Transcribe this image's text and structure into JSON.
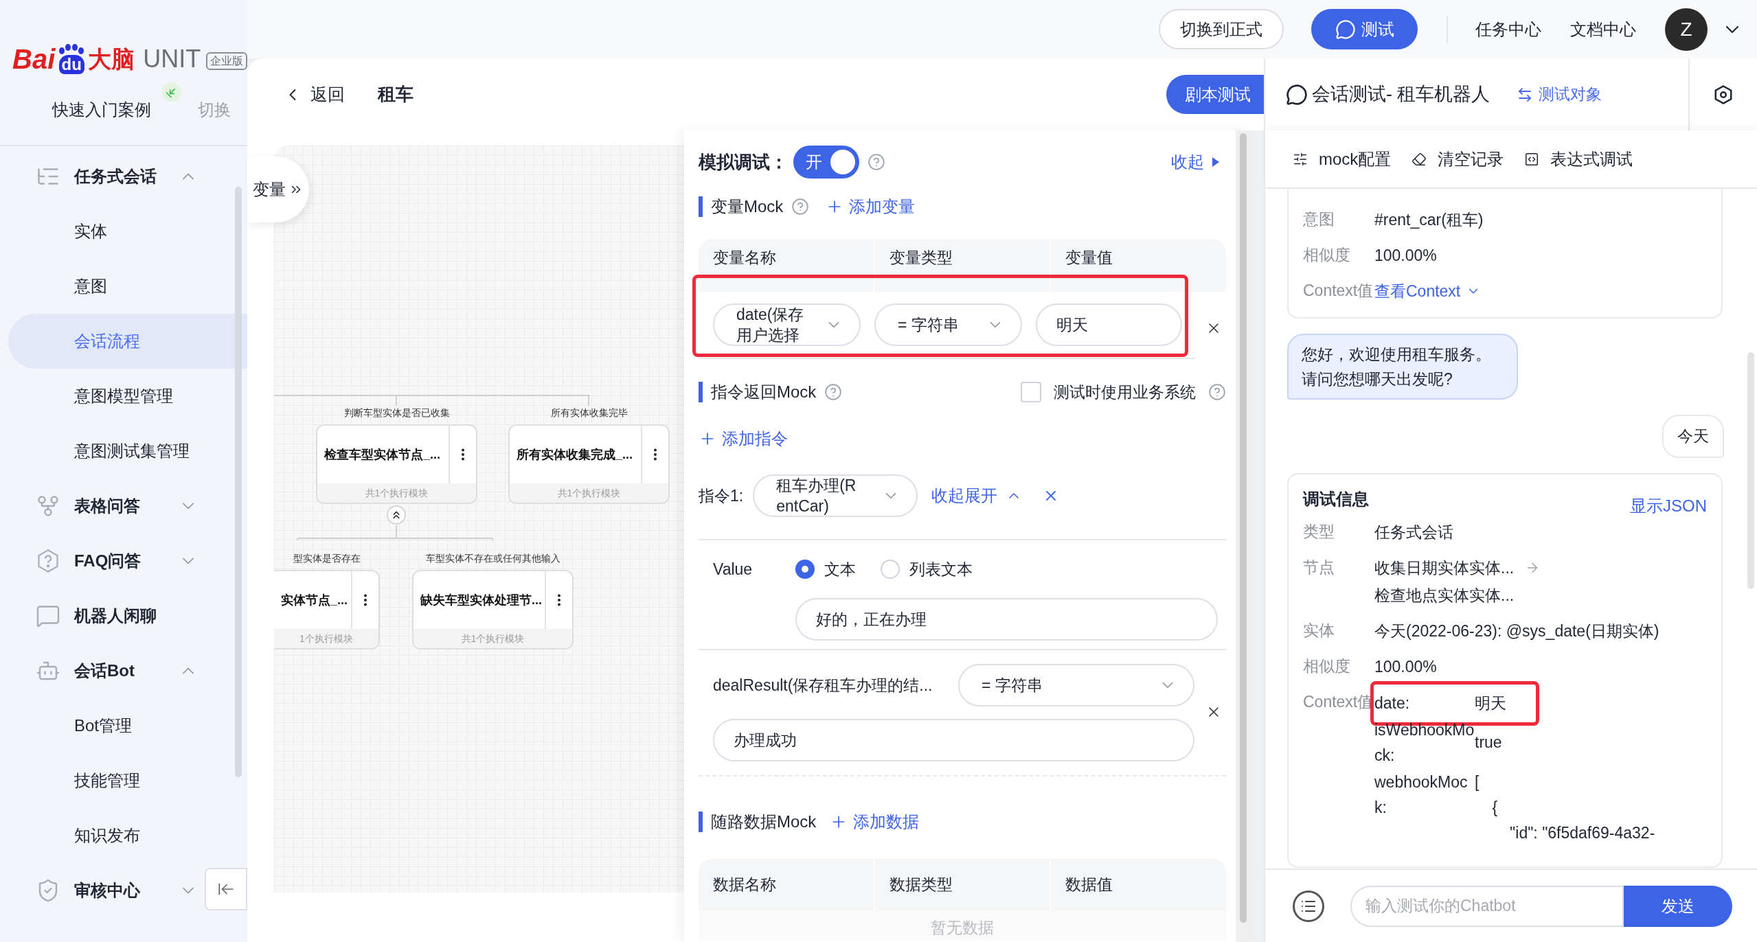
{
  "logo": {
    "brand": "Bai",
    "paw": "du",
    "product": "大脑",
    "name": "UNIT",
    "edition": "企业版"
  },
  "sidebar": {
    "project": "快速入门案例",
    "switch": "切换",
    "items": [
      {
        "label": "任务式会话",
        "expanded": true,
        "children": [
          {
            "label": "实体",
            "selected": false
          },
          {
            "label": "意图",
            "selected": false
          },
          {
            "label": "会话流程",
            "selected": true
          },
          {
            "label": "意图模型管理",
            "selected": false
          },
          {
            "label": "意图测试集管理",
            "selected": false
          }
        ]
      },
      {
        "label": "表格问答",
        "expanded": false
      },
      {
        "label": "FAQ问答",
        "expanded": false
      },
      {
        "label": "机器人闲聊"
      },
      {
        "label": "会话Bot",
        "expanded": true,
        "children": [
          {
            "label": "Bot管理",
            "selected": false
          },
          {
            "label": "技能管理",
            "selected": false
          },
          {
            "label": "知识发布",
            "selected": false
          }
        ]
      },
      {
        "label": "审核中心",
        "expanded": false
      }
    ]
  },
  "topbar": {
    "buttons": [
      {
        "label": "切换到正式",
        "kind": "outline"
      },
      {
        "label": "测试",
        "kind": "primary"
      }
    ],
    "links": [
      "任务中心",
      "文档中心"
    ],
    "avatar": "Z"
  },
  "header": {
    "back": "返回",
    "title": "租车",
    "action": "剧本测试"
  },
  "canvas": {
    "variables": "变量",
    "nodes": [
      {
        "condition": "判断车型实体是否已收集",
        "title": "检查车型实体节点_...",
        "footer": "共1个执行模块"
      },
      {
        "condition": "所有实体收集完毕",
        "title": "所有实体收集完成_...",
        "footer": "共1个执行模块"
      },
      {
        "condition": "型实体是否存在",
        "title": "实体节点_...",
        "footer": "1个执行模块"
      },
      {
        "condition": "车型实体不存在或任何其他输入",
        "title": "缺失车型实体处理节...",
        "footer": "共1个执行模块"
      }
    ]
  },
  "mock": {
    "title": "模拟调试：",
    "toggle": {
      "label": "开",
      "on": true
    },
    "collapse": "收起",
    "variable_mock": {
      "title": "变量Mock",
      "add": "添加变量",
      "columns": [
        "变量名称",
        "变量类型",
        "变量值"
      ],
      "rows": [
        {
          "name": "date(保存用户选择",
          "type": "= 字符串",
          "value": "明天"
        }
      ]
    },
    "command_mock": {
      "title": "指令返回Mock",
      "use_business_system": {
        "label": "测试时使用业务系统",
        "checked": false
      },
      "add": "添加指令",
      "commands": [
        {
          "label": "指令1:",
          "name": "租车办理(RentCar)",
          "toggle": "收起展开",
          "expanded": true,
          "value_label": "Value",
          "value_types": [
            {
              "label": "文本",
              "selected": true
            },
            {
              "label": "列表文本",
              "selected": false
            }
          ],
          "value": "好的，正在办理",
          "variables": [
            {
              "name": "dealResult(保存租车办理的结...",
              "type": "= 字符串",
              "value": "办理成功"
            }
          ]
        }
      ]
    },
    "route_mock": {
      "title": "随路数据Mock",
      "add": "添加数据",
      "columns": [
        "数据名称",
        "数据类型",
        "数据值"
      ],
      "empty": "暂无数据"
    }
  },
  "chat": {
    "title": "会话测试- 租车机器人",
    "target": "测试对象",
    "tools": [
      "mock配置",
      "清空记录",
      "表达式调试"
    ],
    "messages": [
      {
        "kind": "debug",
        "fields": [
          {
            "kind": "text",
            "label": "意图",
            "value": "#rent_car(租车)"
          },
          {
            "kind": "text",
            "label": "相似度",
            "value": "100.00%"
          },
          {
            "kind": "link",
            "label": "Context值",
            "value": "查看Context"
          }
        ]
      },
      {
        "kind": "bot",
        "text": "您好，欢迎使用租车服务。请问您想哪天出发呢?"
      },
      {
        "kind": "user",
        "text": "今天"
      },
      {
        "kind": "debug",
        "title": "调试信息",
        "action": "显示JSON",
        "fields": [
          {
            "kind": "text",
            "label": "类型",
            "value": "任务式会话"
          },
          {
            "kind": "nodes",
            "label": "节点",
            "nodes": [
              "收集日期实体实体...",
              "检查地点实体实体..."
            ]
          },
          {
            "kind": "text",
            "label": "实体",
            "value": "今天(2022-06-23): @sys_date(日期实体)"
          },
          {
            "kind": "text",
            "label": "相似度",
            "value": "100.00%"
          },
          {
            "kind": "context",
            "label": "Context值",
            "entries": [
              {
                "key": "date:",
                "value": "明天"
              },
              {
                "key": "isWebhookMock:",
                "value": "true"
              },
              {
                "key": "webhookMock:",
                "value": "[\n    {\n        \"id\": \"6f5daf69-4a32-"
              }
            ]
          }
        ]
      }
    ],
    "input": {
      "placeholder": "输入测试你的Chatbot"
    },
    "send": "发送"
  }
}
